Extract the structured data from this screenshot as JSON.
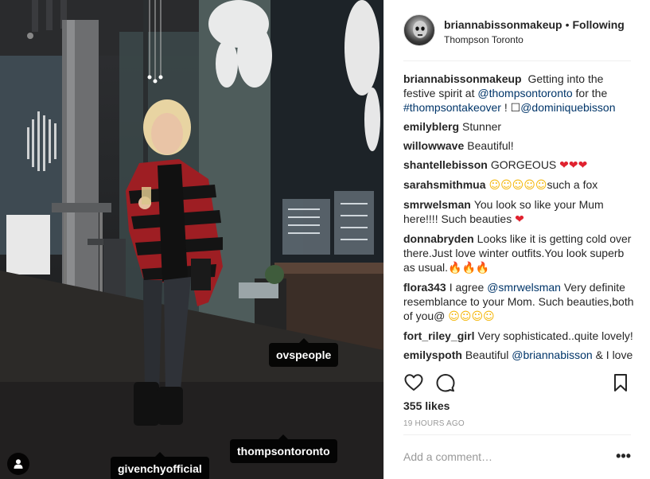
{
  "photo": {
    "tags": {
      "ovs": "ovspeople",
      "thompson": "thompsontoronto",
      "givenchy": "givenchyofficial"
    },
    "user_tag_icon": "person-icon"
  },
  "header": {
    "username": "briannabissonmakeup",
    "separator": "•",
    "follow_state": "Following",
    "location": "Thompson Toronto"
  },
  "caption": {
    "username": "briannabissonmakeup",
    "text_1": "Getting into the festive spirit at",
    "mention_1": "@thompsontoronto",
    "text_2": "for the",
    "hashtag": "#thompsontakeover",
    "text_3": "! ☐",
    "mention_2": "@dominiquebisson"
  },
  "comments": [
    {
      "user": "emilyblerg",
      "text": "Stunner"
    },
    {
      "user": "willowwave",
      "text": "Beautiful!"
    },
    {
      "user": "shantellebisson",
      "text": "GORGEOUS",
      "emoji": "❤❤❤"
    },
    {
      "user": "sarahsmithmua",
      "emoji": "☺☺☺☺☺",
      "text": "such a fox"
    },
    {
      "user": "smrwelsman",
      "text": "You look so like your Mum here!!!! Such beauties",
      "emoji": "❤"
    },
    {
      "user": "donnabryden",
      "text": "Looks like it is getting cold over there.Just love winter outfits.You look superb as usual.",
      "emoji": "🔥🔥🔥"
    },
    {
      "user": "flora343",
      "text_1": "I agree",
      "mention": "@smrwelsman",
      "text_2": "Very definite resemblance to your Mom. Such beauties,both of you@",
      "emoji": "☺☺☺☺"
    },
    {
      "user": "fort_riley_girl",
      "text": "Very sophisticated..quite lovely!"
    },
    {
      "user": "emilyspoth",
      "text_1": "Beautiful",
      "mention": "@briannabisson",
      "text_2": "& I love"
    }
  ],
  "actions": {
    "like_icon": "heart-icon",
    "comment_icon": "comment-icon",
    "save_icon": "bookmark-icon"
  },
  "likes": "355 likes",
  "time_ago": "19 HOURS AGO",
  "add_comment": {
    "placeholder": "Add a comment…"
  },
  "more_options": "•••",
  "colors": {
    "link": "#003569",
    "heart": "#e0222f",
    "muted": "#999999"
  }
}
